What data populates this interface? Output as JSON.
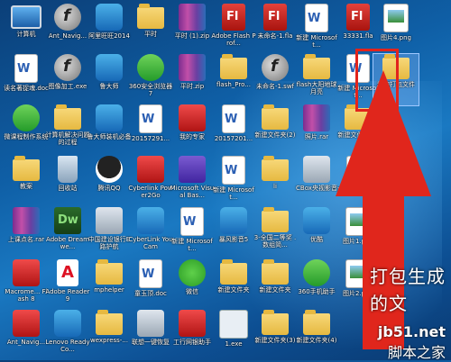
{
  "desktop": {
    "icons": [
      {
        "label": "计算机",
        "type": "comp"
      },
      {
        "label": "Ant_Navig...",
        "type": "swf"
      },
      {
        "label": "阿里旺旺2014",
        "type": "app"
      },
      {
        "label": "平时",
        "type": "folder"
      },
      {
        "label": "平时 (1).zip",
        "type": "rar"
      },
      {
        "label": "Adobe Flash Prof...",
        "type": "fla"
      },
      {
        "label": "未命名-1.fla",
        "type": "fla"
      },
      {
        "label": "新建 Microsoft...",
        "type": "doc"
      },
      {
        "label": "33331.fla",
        "type": "fla"
      },
      {
        "label": "图片4.png",
        "type": "png"
      },
      {
        "label": "读名著捉魂.doc",
        "type": "doc"
      },
      {
        "label": "图像加工.exe",
        "type": "swf"
      },
      {
        "label": "鲁大师",
        "type": "app"
      },
      {
        "label": "360安全浏览器7",
        "type": "green"
      },
      {
        "label": "平时.zip",
        "type": "rar"
      },
      {
        "label": "flash_Pro...",
        "type": "folder"
      },
      {
        "label": "未命名-1.swf",
        "type": "swf"
      },
      {
        "label": "flash大阳地球月亮",
        "type": "folder"
      },
      {
        "label": "新建 Microsoft...",
        "type": "doc"
      },
      {
        "label": "我的打包文件",
        "type": "folder",
        "selected": true
      },
      {
        "label": "微课程制作系统",
        "type": "green"
      },
      {
        "label": "计算机解决问题的过程",
        "type": "folder"
      },
      {
        "label": "鲁大师装机必备",
        "type": "app"
      },
      {
        "label": "20157291...",
        "type": "doc"
      },
      {
        "label": "我的专家",
        "type": "red"
      },
      {
        "label": "20157201...",
        "type": "doc"
      },
      {
        "label": "新建文件夹(2)",
        "type": "folder"
      },
      {
        "label": "照片.rar",
        "type": "rar"
      },
      {
        "label": "新建文件夹(5)",
        "type": "folder"
      },
      {
        "label": "",
        "type": "none"
      },
      {
        "label": "教案",
        "type": "folder"
      },
      {
        "label": "回收站",
        "type": "bin"
      },
      {
        "label": "腾讯QQ",
        "type": "qq"
      },
      {
        "label": "Cyberlink Power2Go",
        "type": "red"
      },
      {
        "label": "Microsoft Visual Bas...",
        "type": "purple"
      },
      {
        "label": "新建 Microsoft...",
        "type": "doc"
      },
      {
        "label": "li",
        "type": "folder"
      },
      {
        "label": "CBox央视影音",
        "type": "gray"
      },
      {
        "label": "工作总结2.doc",
        "type": "doc"
      },
      {
        "label": "",
        "type": "none"
      },
      {
        "label": "上课点名.rar",
        "type": "rar"
      },
      {
        "label": "Adobe Dreamwe...",
        "type": "dw"
      },
      {
        "label": "中国建设银行E路护航",
        "type": "gray"
      },
      {
        "label": "CyberLink YouCam",
        "type": "app"
      },
      {
        "label": "新建 Microsoft...",
        "type": "doc"
      },
      {
        "label": "暴风影音5",
        "type": "app"
      },
      {
        "label": "3-全国二等奖 .数组简...",
        "type": "folder"
      },
      {
        "label": "优酷",
        "type": "app"
      },
      {
        "label": "图片1.png",
        "type": "png"
      },
      {
        "label": "",
        "type": "none"
      },
      {
        "label": "Macrome... Flash 8",
        "type": "red"
      },
      {
        "label": "Adobe Reader 9",
        "type": "pdf"
      },
      {
        "label": "mphelper",
        "type": "folder"
      },
      {
        "label": "童玉顶.doc",
        "type": "doc"
      },
      {
        "label": "微信",
        "type": "wechat"
      },
      {
        "label": "新建文件夹",
        "type": "folder"
      },
      {
        "label": "新建文件夹",
        "type": "folder"
      },
      {
        "label": "360手机助手",
        "type": "green"
      },
      {
        "label": "图片2.png",
        "type": "png"
      },
      {
        "label": "",
        "type": "none"
      },
      {
        "label": "Ant_Navig...",
        "type": "red"
      },
      {
        "label": "Lenovo ReadyCo...",
        "type": "app"
      },
      {
        "label": "wexpress-...",
        "type": "folder"
      },
      {
        "label": "联想一键恢复",
        "type": "gray"
      },
      {
        "label": "工行网银助手",
        "type": "red"
      },
      {
        "label": "1.exe",
        "type": "exe"
      },
      {
        "label": "新建文件夹(3)",
        "type": "folder"
      },
      {
        "label": "新建文件夹(4)",
        "type": "folder"
      },
      {
        "label": "",
        "type": "none"
      },
      {
        "label": "",
        "type": "none"
      }
    ]
  },
  "annotation": {
    "caption": "打包生成的文",
    "watermark_1": "jb51.net",
    "watermark_2": "脚本之家",
    "highlight_color": "#e2241c"
  }
}
